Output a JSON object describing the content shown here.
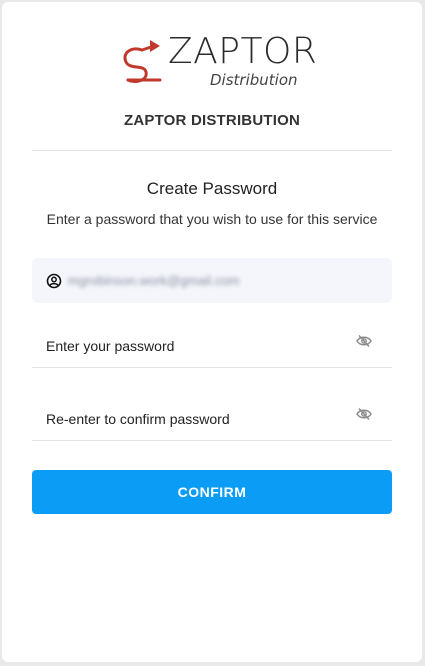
{
  "brand": {
    "logo_word": "ZAPTOR",
    "logo_sub": "Distribution",
    "org_name": "ZAPTOR DISTRIBUTION",
    "logo_color": "#c0392b"
  },
  "form": {
    "title": "Create Password",
    "subtitle": "Enter a password that you wish to use for this service",
    "email": "mgrobinson.work@gmail.com",
    "password_placeholder": "Enter your password",
    "confirm_placeholder": "Re-enter to confirm password",
    "confirm_button": "CONFIRM"
  },
  "colors": {
    "accent": "#0b9df5"
  },
  "icons": {
    "user": "user-circle-icon",
    "eye": "eye-slash-icon"
  }
}
